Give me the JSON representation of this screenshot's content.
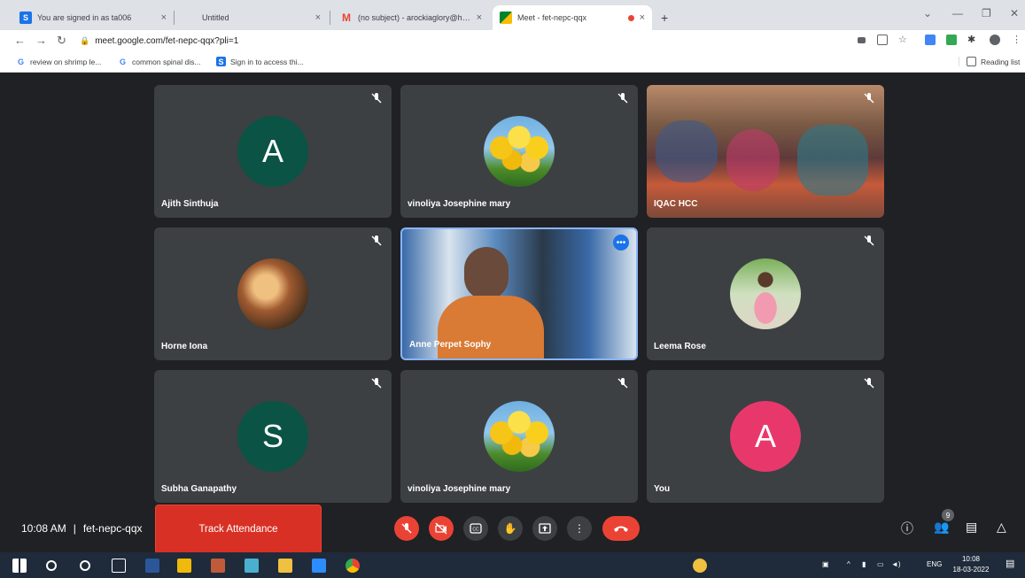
{
  "browser": {
    "tabs": [
      {
        "title": "You are signed in as ta006",
        "favicon": "s-icon",
        "color": "#1a73e8"
      },
      {
        "title": "Untitled",
        "favicon": "blank"
      },
      {
        "title": "(no subject) - arockiaglory@holy",
        "favicon": "gmail-icon",
        "color": "#ea4335"
      },
      {
        "title": "Meet - fet-nepc-qqx",
        "favicon": "meet-icon",
        "color": "#00832d",
        "active": true
      }
    ],
    "new_tab": "+",
    "close": "×",
    "url": "meet.google.com/fet-nepc-qqx?pli=1",
    "bookmarks": [
      {
        "label": "review on shrimp le...",
        "icon": "google-icon"
      },
      {
        "label": "common spinal dis...",
        "icon": "google-icon"
      },
      {
        "label": "Sign in to access thi...",
        "icon": "s-icon"
      }
    ],
    "reading_list": "Reading list"
  },
  "tiles": [
    {
      "name": "Ajith Sinthuja",
      "avatar": "letter",
      "letter": "A",
      "color": "#0b5345"
    },
    {
      "name": "vinoliya Josephine mary",
      "avatar": "tulip"
    },
    {
      "name": "IQAC HCC",
      "avatar": "video-classroom"
    },
    {
      "name": "Horne Iona",
      "avatar": "photo-painting"
    },
    {
      "name": "Anne Perpet Sophy",
      "avatar": "video-speaker",
      "active": true
    },
    {
      "name": "Leema Rose",
      "avatar": "photo-person"
    },
    {
      "name": "Subha Ganapathy",
      "avatar": "letter",
      "letter": "S",
      "color": "#0b5345"
    },
    {
      "name": "vinoliya Josephine mary",
      "avatar": "tulip"
    },
    {
      "name": "You",
      "avatar": "letter",
      "letter": "A",
      "color": "#e8386b"
    }
  ],
  "bottom": {
    "time": "10:08 AM",
    "separator": "|",
    "meeting_code": "fet-nepc-qqx",
    "track_attendance": "Track Attendance",
    "participants_count": "9"
  },
  "taskbar": {
    "lang": "ENG",
    "time": "10:08",
    "date": "18-03-2022"
  }
}
